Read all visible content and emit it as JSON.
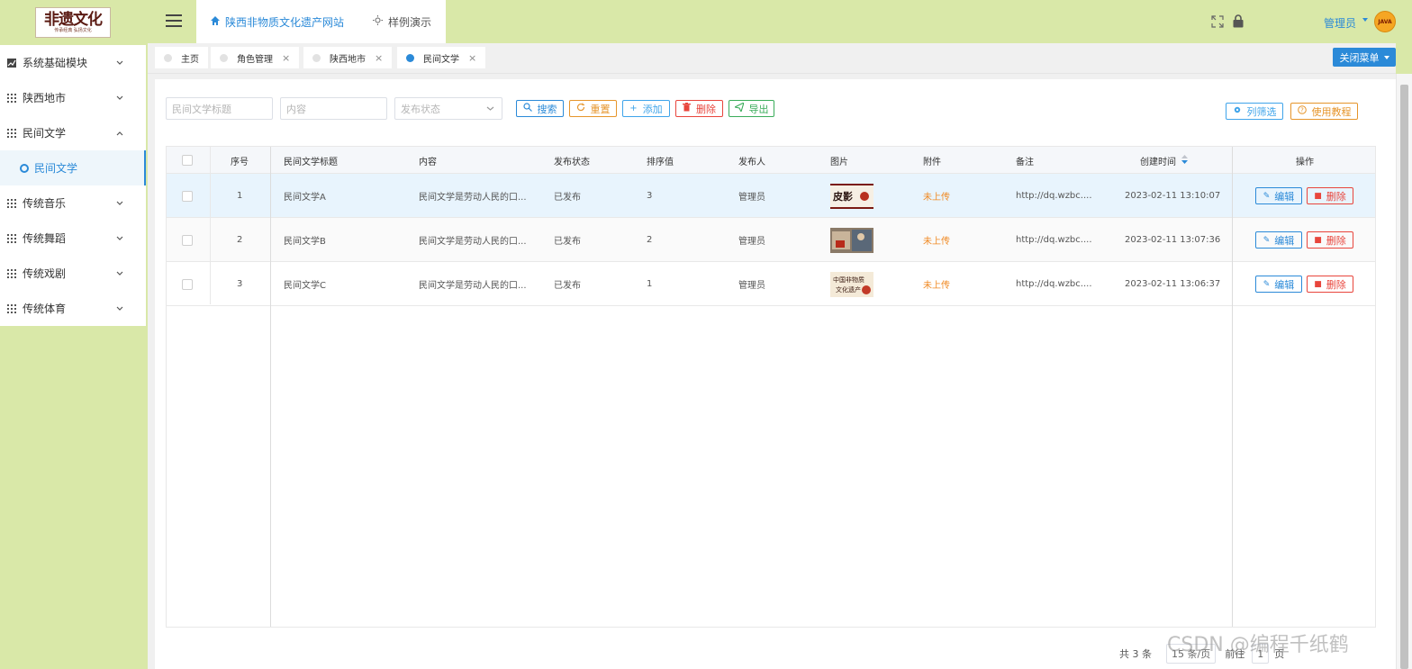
{
  "logo": {
    "title": "非遗文化",
    "subtitle": "传承经典 弘扬文化"
  },
  "sidebar": {
    "items": [
      {
        "label": "系统基础模块"
      },
      {
        "label": "陕西地市"
      },
      {
        "label": "民间文学"
      },
      {
        "label": "传统音乐"
      },
      {
        "label": "传统舞蹈"
      },
      {
        "label": "传统戏剧"
      },
      {
        "label": "传统体育"
      }
    ],
    "submenu_active": "民间文学"
  },
  "header": {
    "top_tabs": [
      {
        "label": "陕西非物质文化遗产网站"
      },
      {
        "label": "样例演示"
      }
    ],
    "admin_label": "管理员",
    "avatar_text": "JAVA"
  },
  "page_tabs": [
    {
      "label": "主页"
    },
    {
      "label": "角色管理"
    },
    {
      "label": "陕西地市"
    },
    {
      "label": "民间文学"
    }
  ],
  "close_menu_label": "关闭菜单",
  "filters": {
    "title_placeholder": "民间文学标题",
    "content_placeholder": "内容",
    "status_placeholder": "发布状态"
  },
  "toolbar": {
    "search": "搜索",
    "reset": "重置",
    "add": "添加",
    "delete": "删除",
    "export": "导出",
    "column_filter": "列筛选",
    "tutorial": "使用教程"
  },
  "table": {
    "headers": [
      "序号",
      "民间文学标题",
      "内容",
      "发布状态",
      "排序值",
      "发布人",
      "图片",
      "附件",
      "备注",
      "创建时间",
      "操作"
    ],
    "rows": [
      {
        "index": "1",
        "title": "民间文学A",
        "content": "民间文学是劳动人民的口...",
        "status": "已发布",
        "sort": "3",
        "publisher": "管理员",
        "attachment": "未上传",
        "note": "http://dq.wzbc....",
        "created": "2023-02-11 13:10:07"
      },
      {
        "index": "2",
        "title": "民间文学B",
        "content": "民间文学是劳动人民的口...",
        "status": "已发布",
        "sort": "2",
        "publisher": "管理员",
        "attachment": "未上传",
        "note": "http://dq.wzbc....",
        "created": "2023-02-11 13:07:36"
      },
      {
        "index": "3",
        "title": "民间文学C",
        "content": "民间文学是劳动人民的口...",
        "status": "已发布",
        "sort": "1",
        "publisher": "管理员",
        "attachment": "未上传",
        "note": "http://dq.wzbc....",
        "created": "2023-02-11 13:06:37"
      }
    ],
    "edit_label": "编辑",
    "delete_label": "删除"
  },
  "pagination": {
    "total": "共 3 条",
    "page_size": "15 条/页",
    "goto": "前往",
    "page": "1",
    "unit": "页"
  },
  "watermark": "CSDN @编程千纸鹤",
  "colors": {
    "accent": "#2b8ad8",
    "sidebar_bg": "#d9e8a8",
    "danger": "#e8453c",
    "warning": "#e6952b"
  }
}
